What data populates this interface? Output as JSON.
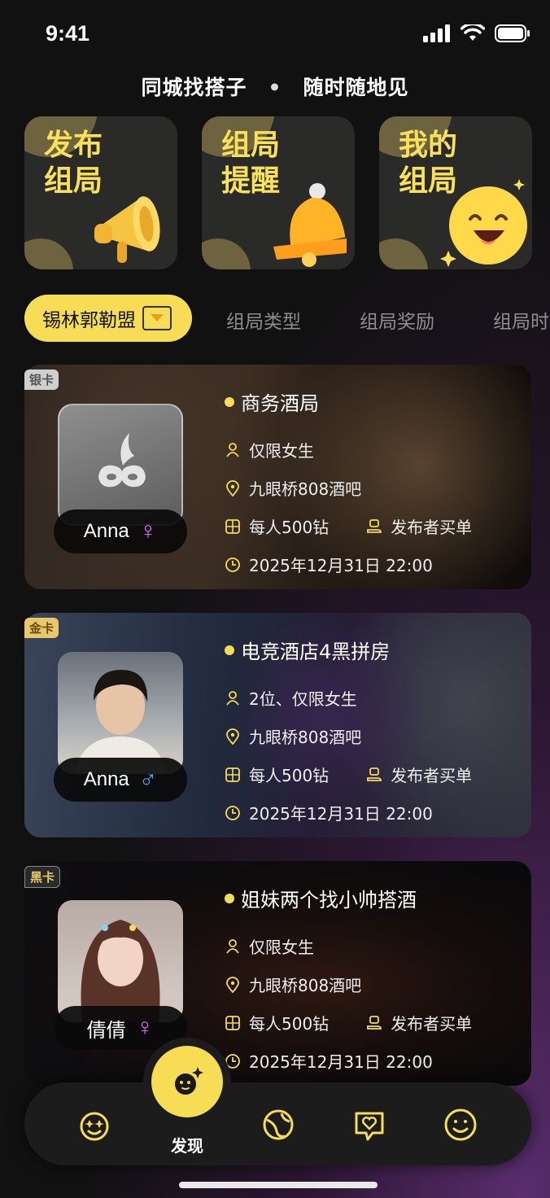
{
  "status": {
    "time": "9:41"
  },
  "tagline": {
    "left": "同城找搭子",
    "dot": "•",
    "right": "随时随地见"
  },
  "features": [
    {
      "title": "发布组局",
      "icon": "megaphone-icon"
    },
    {
      "title": "组局提醒",
      "icon": "bell-icon"
    },
    {
      "title": "我的组局",
      "icon": "smile-face-icon"
    }
  ],
  "tabs": {
    "active": "锡林郭勒盟",
    "items": [
      "组局类型",
      "组局奖励",
      "组局时"
    ]
  },
  "events": [
    {
      "badge": "银卡",
      "title": "商务酒局",
      "name": "Anna",
      "gender": "female",
      "gender_symbol": "♀",
      "requirement": "仅限女生",
      "location": "九眼桥808酒吧",
      "price": "每人500钻",
      "payer": "发布者买单",
      "time": "2025年12月31日 22:00"
    },
    {
      "badge": "金卡",
      "title": "电竞酒店4黑拼房",
      "name": "Anna",
      "gender": "male",
      "gender_symbol": "♂",
      "requirement": "2位、仅限女生",
      "location": "九眼桥808酒吧",
      "price": "每人500钻",
      "payer": "发布者买单",
      "time": "2025年12月31日 22:00"
    },
    {
      "badge": "黑卡",
      "title": "姐妹两个找小帅搭酒",
      "name": "倩倩",
      "gender": "female",
      "gender_symbol": "♀",
      "requirement": "仅限女生",
      "location": "九眼桥808酒吧",
      "price": "每人500钻",
      "payer": "发布者买单",
      "time": "2025年12月31日 22:00"
    }
  ],
  "tabbar": {
    "active_label": "发现",
    "items": [
      "star-face-icon",
      "discover-icon",
      "planet-icon",
      "heart-chat-icon",
      "smile-icon"
    ]
  },
  "colors": {
    "accent": "#f6dd55",
    "female": "#d86bff",
    "male": "#4aa8ff"
  }
}
